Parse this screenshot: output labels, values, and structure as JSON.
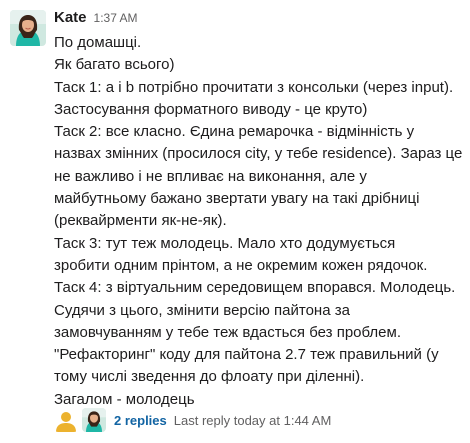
{
  "message": {
    "author": "Kate",
    "timestamp": "1:37 AM",
    "lines": [
      "По домашці.",
      "Як багато всього)",
      "Таск 1: a і b потрібно прочитати з консольки (через input).",
      "Застосування форматного виводу - це круто)",
      "Таск 2: все класно. Єдина ремарочка - відмінність у",
      "назвах змінних (просилося city, у тебе residence). Зараз це",
      "не важливо і не впливає на виконання, але у",
      "майбутньому бажано звертати увагу на такі дрібниці",
      "(реквайрменти як-не-як).",
      "Таск 3: тут теж молодець. Мало хто додумується",
      "зробити одним прінтом, а не окремим кожен рядочок.",
      "Таск 4: з віртуальним середовищем впорався. Молодець.",
      "Судячи з цього, змінити версію пайтона за",
      "замовчуванням у тебе теж вдасться без проблем.",
      "\"Рефакторинг\" коду для пайтона 2.7 теж правильний (у",
      "тому числі зведення до флоату при діленні).",
      "Загалом - молодець"
    ]
  },
  "thread": {
    "replies_label": "2 replies",
    "last_reply_label": "Last reply today at 1:44 AM"
  },
  "colors": {
    "link": "#1264a3",
    "muted": "#616061",
    "text": "#1d1c1d"
  },
  "icons": {
    "author_avatar": "author-avatar-photo",
    "reply_avatar_1": "default-user-avatar",
    "reply_avatar_2": "author-avatar-photo"
  }
}
